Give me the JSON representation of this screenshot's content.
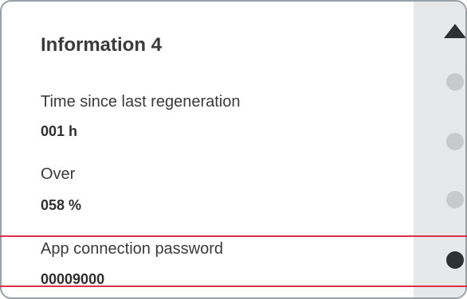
{
  "panel": {
    "title": "Information 4",
    "items": [
      {
        "label": "Time since last regeneration",
        "value": "001 h"
      },
      {
        "label": "Over",
        "value": "058 %"
      },
      {
        "label": "App connection password",
        "value": "00009000"
      }
    ]
  },
  "scrollbar": {
    "up_icon": "triangle-up-icon",
    "page_count": 4,
    "current_page": 4
  },
  "colors": {
    "highlight": "#d9304a",
    "active_dot": "#2e3033",
    "inactive_dot": "#c7cacd",
    "scrollbar_bg": "#e6e8ea"
  }
}
